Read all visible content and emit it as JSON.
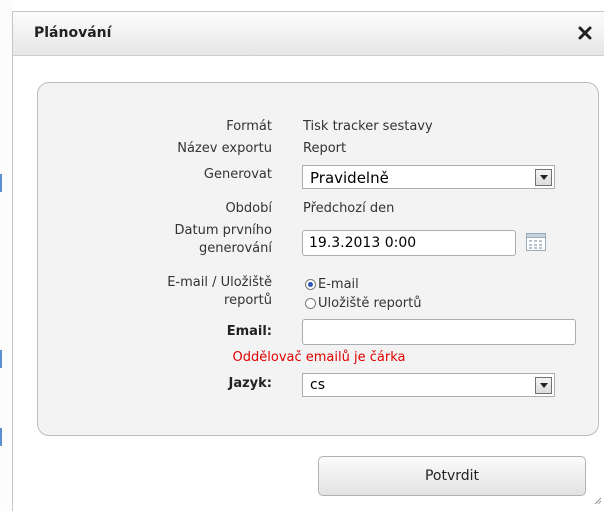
{
  "dialog": {
    "title": "Plánování",
    "close_icon": "close-icon"
  },
  "form": {
    "format": {
      "label": "Formát",
      "value": "Tisk tracker sestavy"
    },
    "export_name": {
      "label": "Název exportu",
      "value": "Report"
    },
    "generate": {
      "label": "Generovat",
      "selected": "Pravidelně"
    },
    "period": {
      "label": "Období",
      "value": "Předchozí den"
    },
    "first_date": {
      "label_line1": "Datum prvního",
      "label_line2": "generování",
      "value": "19.3.2013 0:00",
      "icon": "calendar-icon"
    },
    "destination": {
      "label_line1": "E-mail / Uložiště",
      "label_line2": "reportů",
      "options": [
        {
          "label": "E-mail",
          "checked": true
        },
        {
          "label": "Uložiště reportů",
          "checked": false
        }
      ]
    },
    "email": {
      "label": "Email:",
      "value": "",
      "hint": "Oddělovač emailů je čárka"
    },
    "language": {
      "label": "Jazyk:",
      "selected": "cs"
    }
  },
  "buttons": {
    "confirm_label": "Potvrdit"
  },
  "colors": {
    "accent": "#2b58b8",
    "error": "#e00000",
    "panel_bg": "#f3f3f3"
  }
}
